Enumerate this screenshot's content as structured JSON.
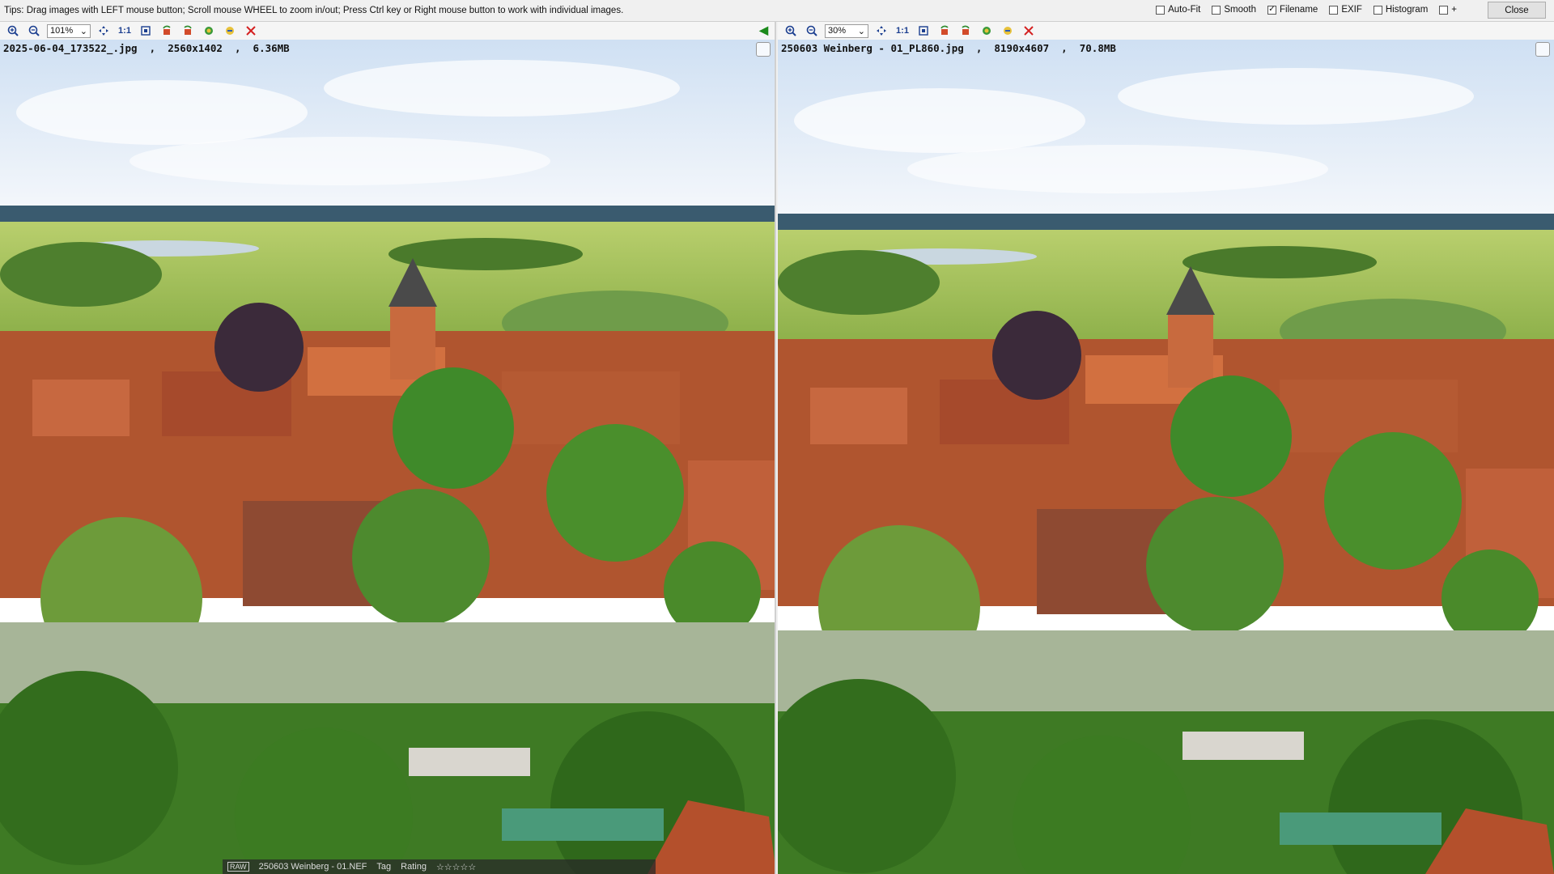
{
  "tips": "Tips: Drag images with LEFT mouse button; Scroll mouse WHEEL to zoom in/out; Press Ctrl key or Right mouse button to work with individual images.",
  "options": [
    {
      "label": "Auto-Fit",
      "checked": false
    },
    {
      "label": "Smooth",
      "checked": false
    },
    {
      "label": "Filename",
      "checked": true
    },
    {
      "label": "EXIF",
      "checked": false
    },
    {
      "label": "Histogram",
      "checked": false
    },
    {
      "label": "+",
      "checked": false
    }
  ],
  "close_label": "Close",
  "left": {
    "zoom": "101%",
    "one_to_one": "1:1",
    "filename": "2025-06-04_173522_.jpg  ,  2560x1402  ,  6.36MB"
  },
  "right": {
    "zoom": "30%",
    "one_to_one": "1:1",
    "filename": "250603 Weinberg - 01_PL860.jpg  ,  8190x4607  ,  70.8MB"
  },
  "bottombar": {
    "raw": "RAW",
    "file": "250603 Weinberg - 01.NEF",
    "tag": "Tag",
    "rating": "Rating"
  },
  "colors": {
    "sky": "#dfeaf6",
    "meadow": "#9fc25a",
    "roof": "#c8643a",
    "tree": "#3c7a22"
  }
}
